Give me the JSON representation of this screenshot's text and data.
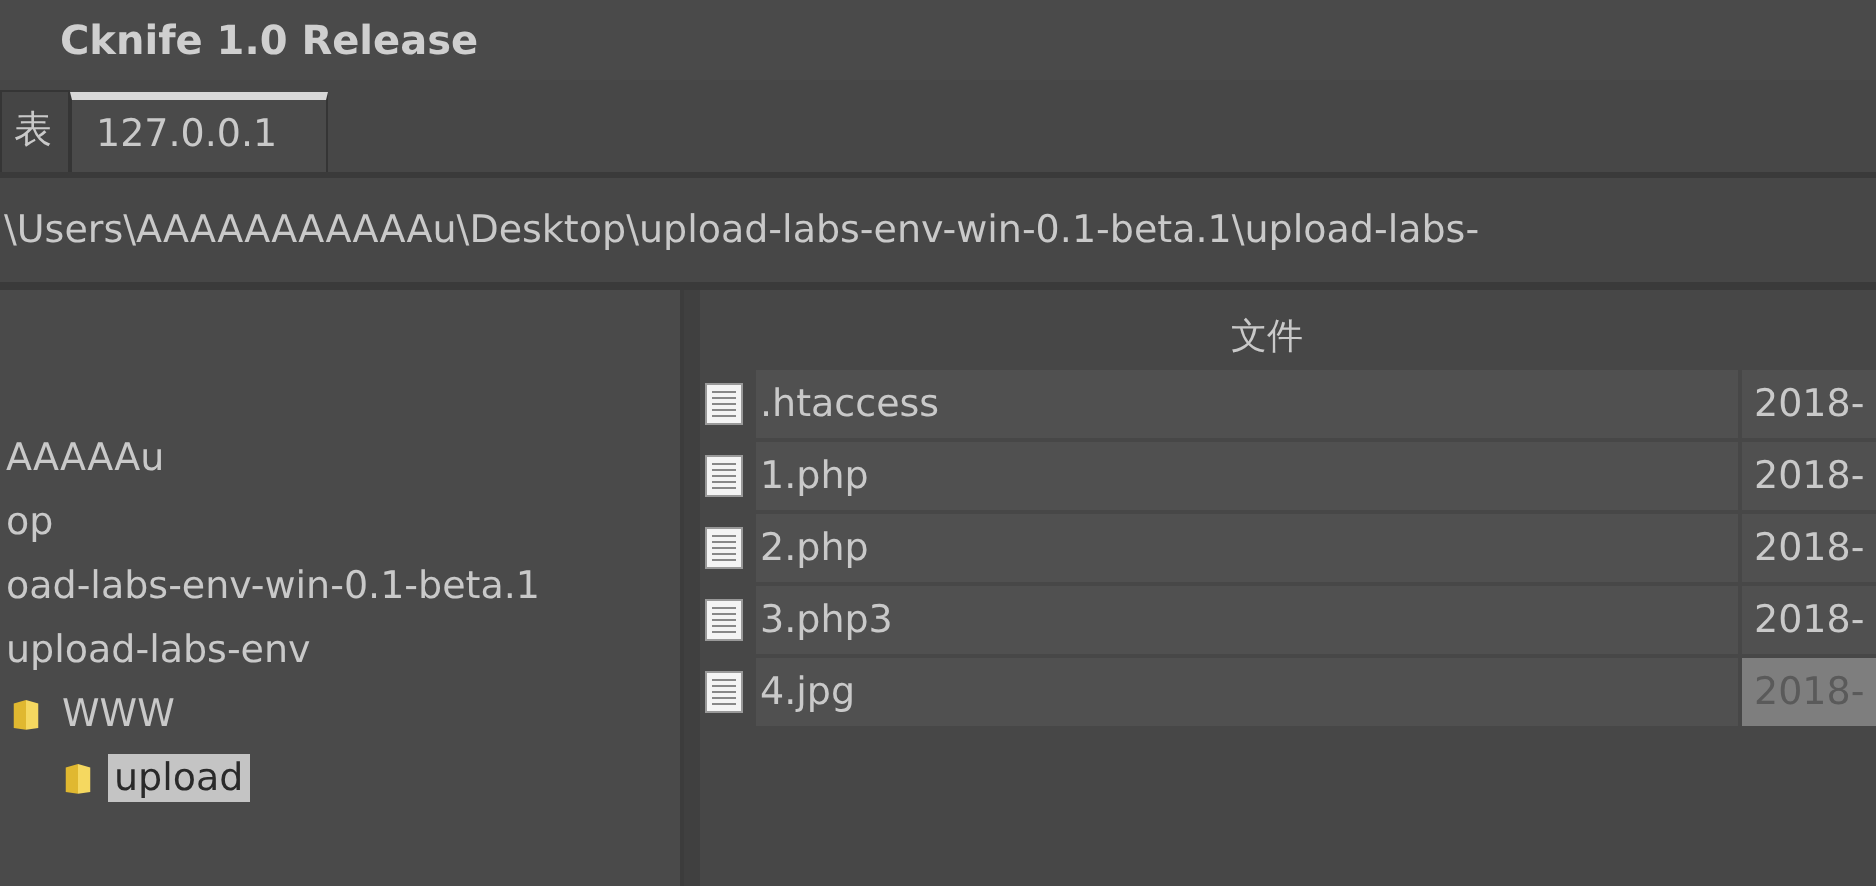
{
  "window": {
    "title": "Cknife 1.0 Release"
  },
  "tabs": [
    {
      "label": "表",
      "selected": false
    },
    {
      "label": "127.0.0.1",
      "selected": true
    }
  ],
  "path": "\\Users\\AAAAAAAAAAAu\\Desktop\\upload-labs-env-win-0.1-beta.1\\upload-labs-",
  "tree": [
    {
      "label": "AAAAAu",
      "kind": "plain",
      "selected": false,
      "children": [
        {
          "label": "op",
          "kind": "plain",
          "selected": false,
          "children": [
            {
              "label": "oad-labs-env-win-0.1-beta.1",
              "kind": "plain",
              "selected": false,
              "children": [
                {
                  "label": "upload-labs-env",
                  "kind": "plain",
                  "selected": false,
                  "children": [
                    {
                      "label": "WWW",
                      "kind": "folder",
                      "selected": false,
                      "children": [
                        {
                          "label": "upload",
                          "kind": "folder",
                          "selected": true
                        }
                      ]
                    }
                  ]
                }
              ]
            }
          ]
        }
      ]
    }
  ],
  "table": {
    "columns": [
      "文件"
    ],
    "rows": [
      {
        "name": ".htaccess",
        "date": "2018-",
        "selected": false
      },
      {
        "name": "1.php",
        "date": "2018-",
        "selected": false
      },
      {
        "name": "2.php",
        "date": "2018-",
        "selected": false
      },
      {
        "name": "3.php3",
        "date": "2018-",
        "selected": false
      },
      {
        "name": "4.jpg",
        "date": "2018-",
        "selected": true
      }
    ]
  }
}
